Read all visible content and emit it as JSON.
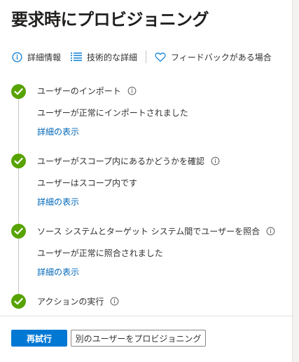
{
  "header": {
    "title": "要求時にプロビジョニング"
  },
  "toolbar": {
    "details_label": "詳細情報",
    "technical_label": "技術的な詳細",
    "feedback_label": "フィードバックがある場合"
  },
  "steps": [
    {
      "title": "ユーザーのインポート",
      "status": "ユーザーが正常にインポートされました",
      "link": "詳細の表示"
    },
    {
      "title": "ユーザーがスコープ内にあるかどうかを確認",
      "status": "ユーザーはスコープ内です",
      "link": "詳細の表示"
    },
    {
      "title": "ソース システムとターゲット システム間でユーザーを照合",
      "status": "ユーザーが正常に照合されました",
      "link": "詳細の表示"
    },
    {
      "title": "アクションの実行"
    }
  ],
  "footer": {
    "retry_label": "再試行",
    "provision_other_label": "別のユーザーをプロビジョニング"
  },
  "colors": {
    "accent": "#0078d4",
    "success": "#57a300",
    "link": "#0067b8"
  }
}
